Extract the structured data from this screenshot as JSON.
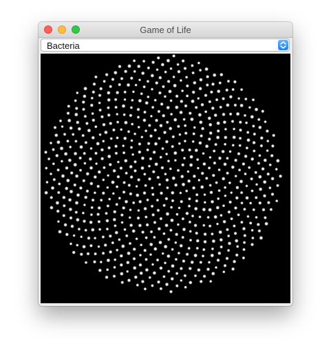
{
  "window": {
    "title": "Game of Life"
  },
  "simulation_select": {
    "selected": "Bacteria"
  },
  "canvas": {
    "description_icon": "grid-canvas"
  },
  "colors": {
    "background": "#000000",
    "cell": "#f2f2f2",
    "close": "#fc605c",
    "minimize": "#fdbc40",
    "maximize": "#34c84a",
    "accent": "#1a82fb"
  }
}
